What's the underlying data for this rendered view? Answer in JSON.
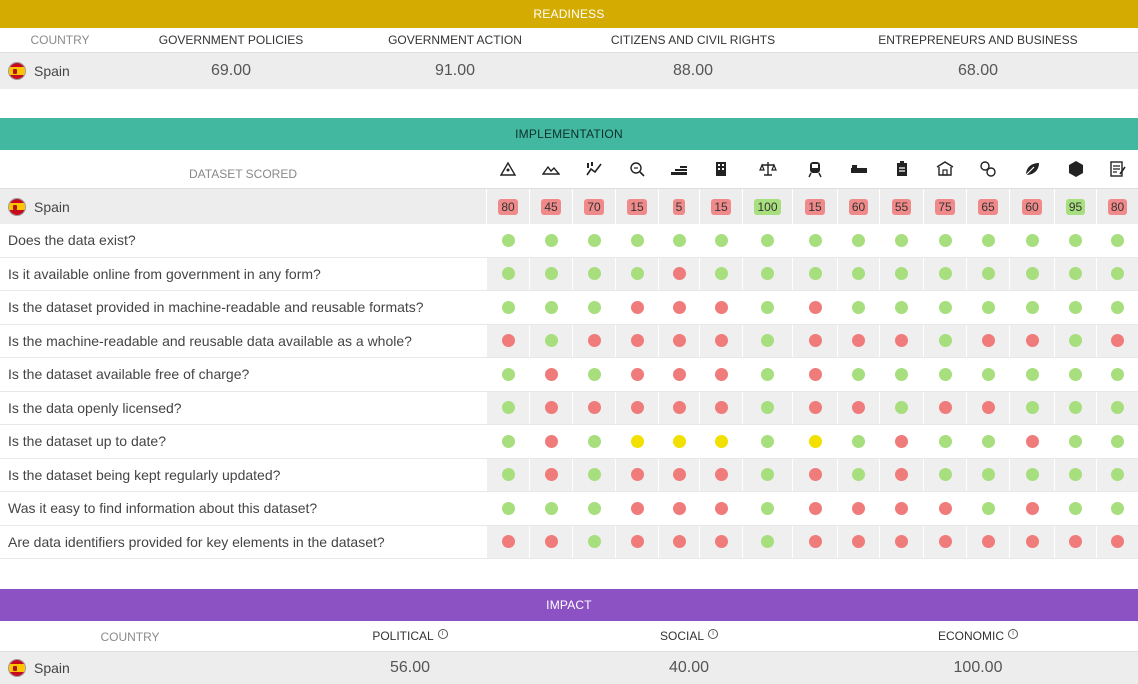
{
  "readiness": {
    "band_label": "READINESS",
    "headers": {
      "country": "COUNTRY",
      "gov_policies": "GOVERNMENT POLICIES",
      "gov_action": "GOVERNMENT ACTION",
      "citizens": "CITIZENS AND CIVIL RIGHTS",
      "entrepreneurs": "ENTREPRENEURS AND BUSINESS"
    },
    "row": {
      "country": "Spain",
      "gov_policies": "69.00",
      "gov_action": "91.00",
      "citizens": "88.00",
      "entrepreneurs": "68.00"
    }
  },
  "implementation": {
    "band_label": "IMPLEMENTATION",
    "dataset_scored_label": "DATASET SCORED",
    "columns": [
      {
        "icon": "map-icon",
        "score": "80",
        "status": "r"
      },
      {
        "icon": "land-icon",
        "score": "45",
        "status": "r"
      },
      {
        "icon": "stats-icon",
        "score": "70",
        "status": "r"
      },
      {
        "icon": "budget-icon",
        "score": "15",
        "status": "r"
      },
      {
        "icon": "spending-icon",
        "score": "5",
        "status": "r"
      },
      {
        "icon": "company-icon",
        "score": "15",
        "status": "r"
      },
      {
        "icon": "legislation-icon",
        "score": "100",
        "status": "g"
      },
      {
        "icon": "transport-icon",
        "score": "15",
        "status": "r"
      },
      {
        "icon": "health-icon",
        "score": "60",
        "status": "r"
      },
      {
        "icon": "education-icon",
        "score": "55",
        "status": "r"
      },
      {
        "icon": "government-icon",
        "score": "75",
        "status": "r"
      },
      {
        "icon": "crime-icon",
        "score": "65",
        "status": "r"
      },
      {
        "icon": "environment-icon",
        "score": "60",
        "status": "r"
      },
      {
        "icon": "elections-icon",
        "score": "95",
        "status": "g"
      },
      {
        "icon": "contracts-icon",
        "score": "80",
        "status": "r"
      }
    ],
    "country": "Spain",
    "questions": [
      {
        "text": "Does the data exist?",
        "dots": [
          "g",
          "g",
          "g",
          "g",
          "g",
          "g",
          "g",
          "g",
          "g",
          "g",
          "g",
          "g",
          "g",
          "g",
          "g"
        ]
      },
      {
        "text": "Is it available online from government in any form?",
        "dots": [
          "g",
          "g",
          "g",
          "g",
          "r",
          "g",
          "g",
          "g",
          "g",
          "g",
          "g",
          "g",
          "g",
          "g",
          "g"
        ]
      },
      {
        "text": "Is the dataset provided in machine-readable and reusable formats?",
        "dots": [
          "g",
          "g",
          "g",
          "r",
          "r",
          "r",
          "g",
          "r",
          "g",
          "g",
          "g",
          "g",
          "g",
          "g",
          "g"
        ]
      },
      {
        "text": "Is the machine-readable and reusable data available as a whole?",
        "dots": [
          "r",
          "g",
          "r",
          "r",
          "r",
          "r",
          "g",
          "r",
          "r",
          "r",
          "g",
          "r",
          "r",
          "g",
          "r"
        ]
      },
      {
        "text": "Is the dataset available free of charge?",
        "dots": [
          "g",
          "r",
          "g",
          "r",
          "r",
          "r",
          "g",
          "r",
          "g",
          "g",
          "g",
          "g",
          "g",
          "g",
          "g"
        ]
      },
      {
        "text": "Is the data openly licensed?",
        "dots": [
          "g",
          "r",
          "r",
          "r",
          "r",
          "r",
          "g",
          "r",
          "r",
          "g",
          "r",
          "r",
          "g",
          "g",
          "g"
        ]
      },
      {
        "text": "Is the dataset up to date?",
        "dots": [
          "g",
          "r",
          "g",
          "y",
          "y",
          "y",
          "g",
          "y",
          "g",
          "r",
          "g",
          "g",
          "r",
          "g",
          "g"
        ]
      },
      {
        "text": "Is the dataset being kept regularly updated?",
        "dots": [
          "g",
          "r",
          "g",
          "r",
          "r",
          "r",
          "g",
          "r",
          "g",
          "r",
          "g",
          "g",
          "g",
          "g",
          "g"
        ]
      },
      {
        "text": "Was it easy to find information about this dataset?",
        "dots": [
          "g",
          "g",
          "g",
          "r",
          "r",
          "r",
          "g",
          "r",
          "r",
          "r",
          "r",
          "g",
          "r",
          "g",
          "g"
        ]
      },
      {
        "text": "Are data identifiers provided for key elements in the dataset?",
        "dots": [
          "r",
          "r",
          "g",
          "r",
          "r",
          "r",
          "g",
          "r",
          "r",
          "r",
          "r",
          "r",
          "r",
          "r",
          "r"
        ]
      }
    ]
  },
  "impact": {
    "band_label": "IMPACT",
    "headers": {
      "country": "COUNTRY",
      "political": "POLITICAL",
      "social": "SOCIAL",
      "economic": "ECONOMIC"
    },
    "info_glyph": "i",
    "row": {
      "country": "Spain",
      "political": "56.00",
      "social": "40.00",
      "economic": "100.00"
    }
  }
}
